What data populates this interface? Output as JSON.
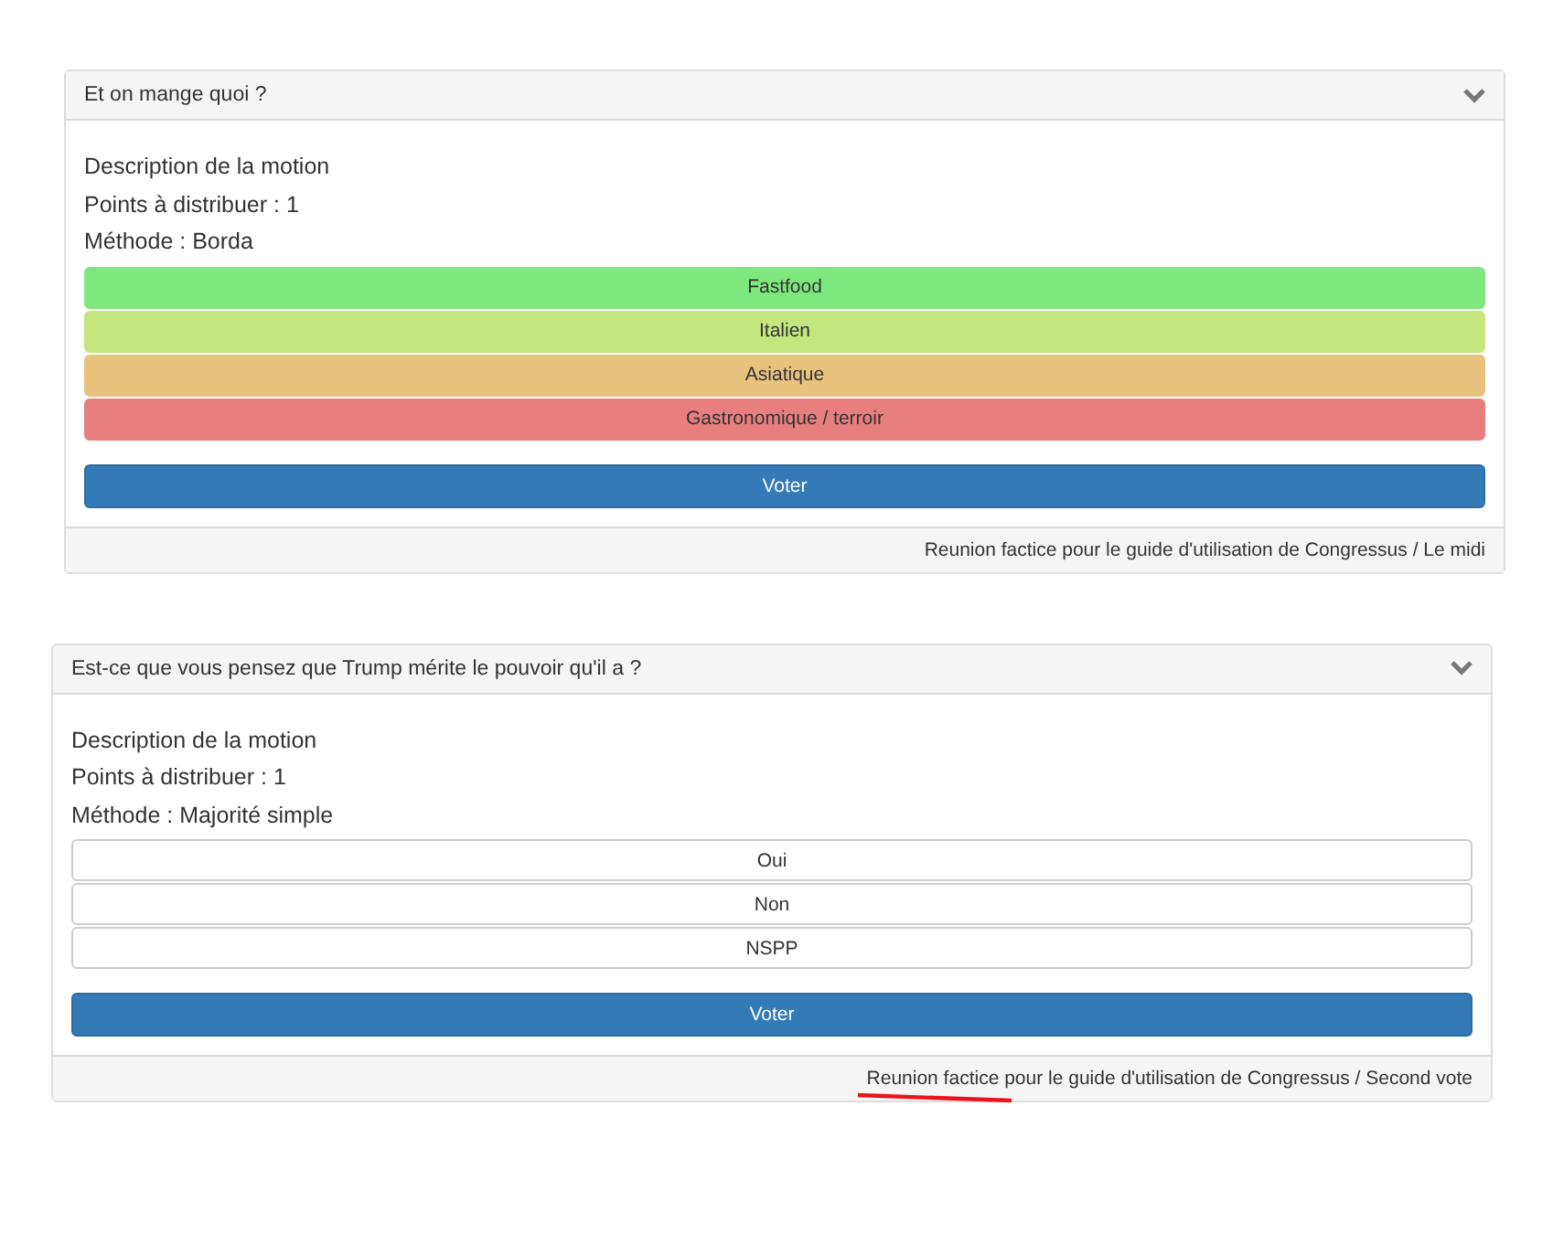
{
  "motions": [
    {
      "title": "Et on mange quoi ?",
      "description": "Description de la motion",
      "points": "Points à distribuer : 1",
      "method": "Méthode : Borda",
      "options": [
        {
          "label": "Fastfood",
          "color": "#7ee87e"
        },
        {
          "label": "Italien",
          "color": "#c5e67e"
        },
        {
          "label": "Asiatique",
          "color": "#e8c37e"
        },
        {
          "label": "Gastronomique / terroir",
          "color": "#e87e7e"
        }
      ],
      "vote_button": "Voter",
      "footer": "Reunion factice pour le guide d'utilisation de Congressus / Le midi",
      "underlined": false
    },
    {
      "title": "Est-ce que vous pensez que Trump mérite le pouvoir qu'il a ?",
      "description": "Description de la motion",
      "points": "Points à distribuer : 1",
      "method": "Méthode : Majorité simple",
      "options": [
        {
          "label": "Oui",
          "color": "#ffffff"
        },
        {
          "label": "Non",
          "color": "#ffffff"
        },
        {
          "label": "NSPP",
          "color": "#ffffff"
        }
      ],
      "vote_button": "Voter",
      "footer": "Reunion factice pour le guide d'utilisation de Congressus / Second vote",
      "underlined": true
    }
  ]
}
